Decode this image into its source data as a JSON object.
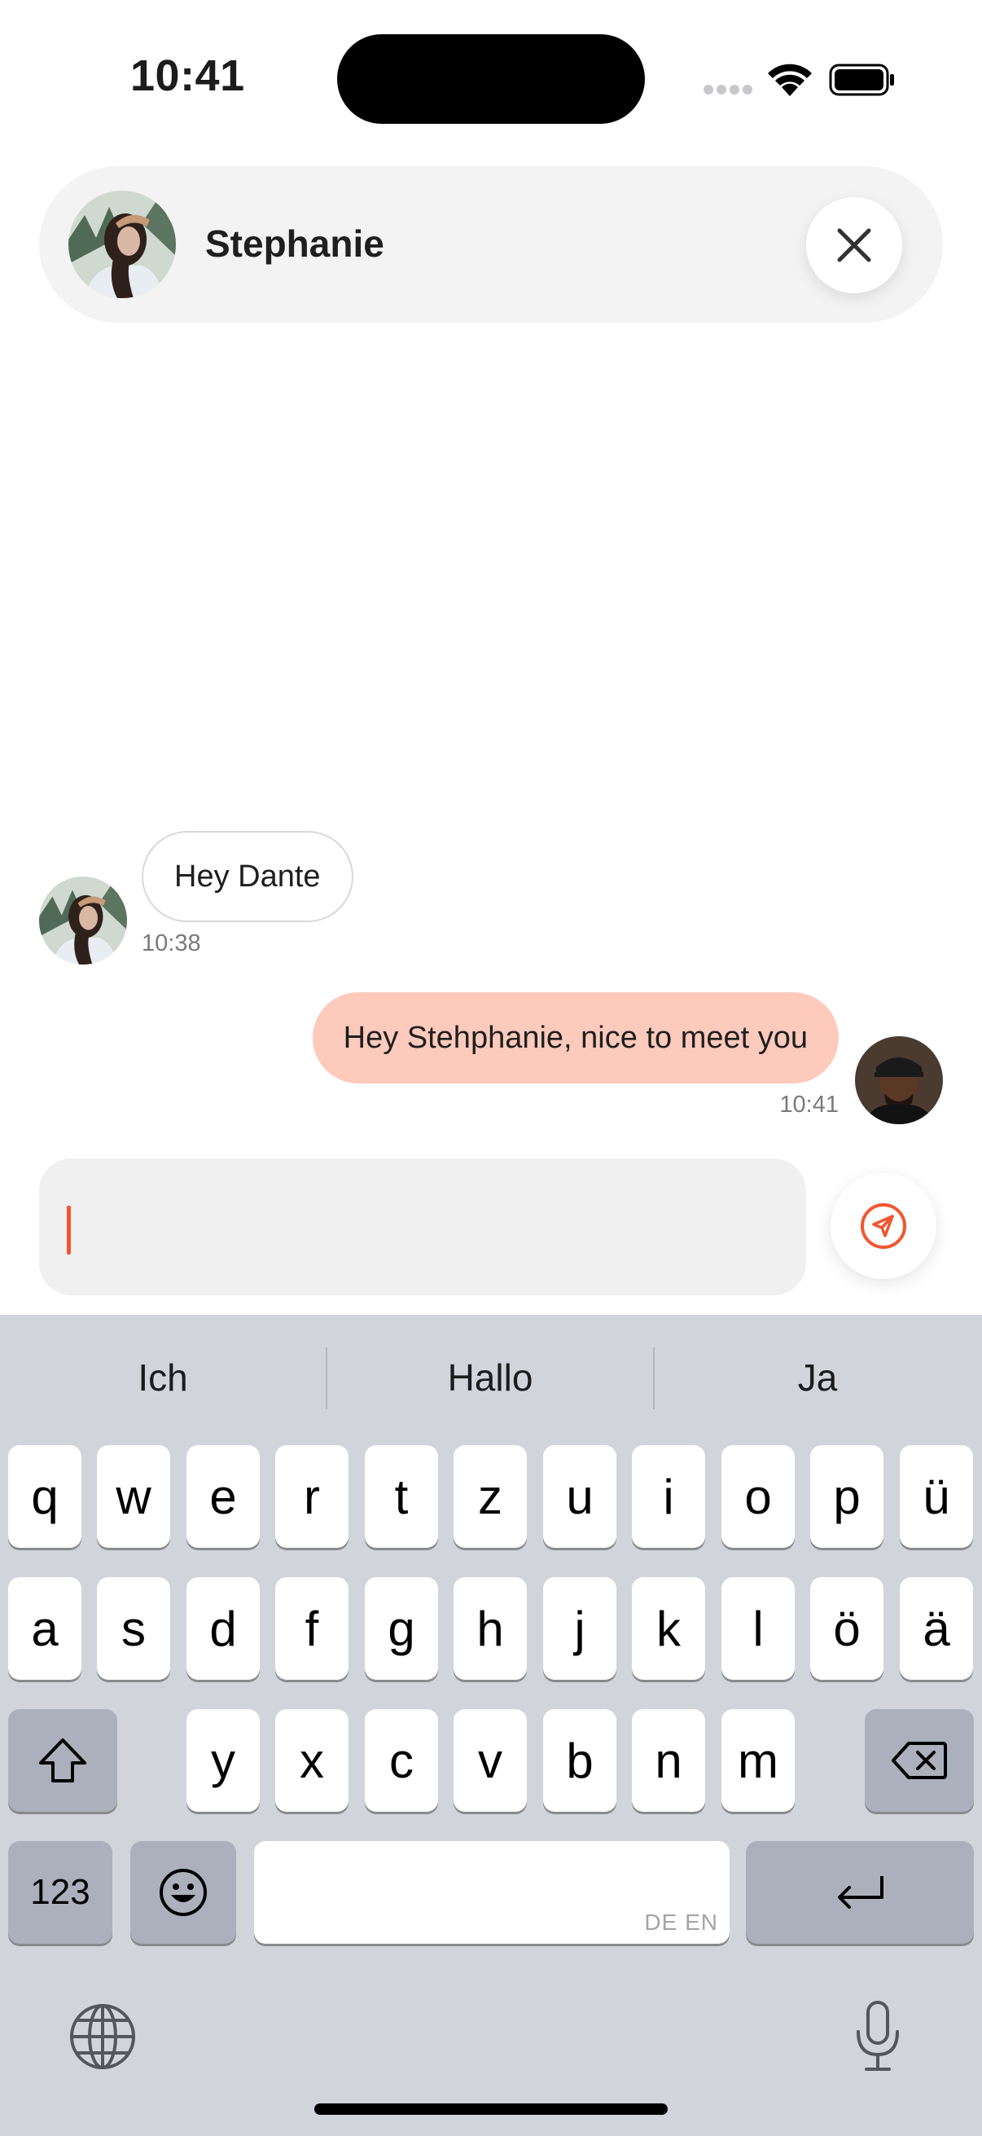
{
  "status_bar": {
    "time": "10:41"
  },
  "chat": {
    "contact_name": "Stephanie",
    "close_icon": "close-icon"
  },
  "messages": [
    {
      "direction": "incoming",
      "text": "Hey Dante",
      "time": "10:38"
    },
    {
      "direction": "outgoing",
      "text": "Hey Stehphanie, nice to meet you",
      "time": "10:41"
    }
  ],
  "composer": {
    "value": "",
    "send_icon": "send-icon"
  },
  "keyboard": {
    "suggestions": [
      "Ich",
      "Hallo",
      "Ja"
    ],
    "row1": [
      "q",
      "w",
      "e",
      "r",
      "t",
      "z",
      "u",
      "i",
      "o",
      "p",
      "ü"
    ],
    "row2": [
      "a",
      "s",
      "d",
      "f",
      "g",
      "h",
      "j",
      "k",
      "l",
      "ö",
      "ä"
    ],
    "row3": [
      "y",
      "x",
      "c",
      "v",
      "b",
      "n",
      "m"
    ],
    "numbers_label": "123",
    "space_hint": "DE EN"
  },
  "colors": {
    "accent": "#f0562f",
    "outgoing_bubble": "#fdcabb",
    "header_bg": "#f3f3f3",
    "keyboard_bg": "#d1d4db"
  }
}
